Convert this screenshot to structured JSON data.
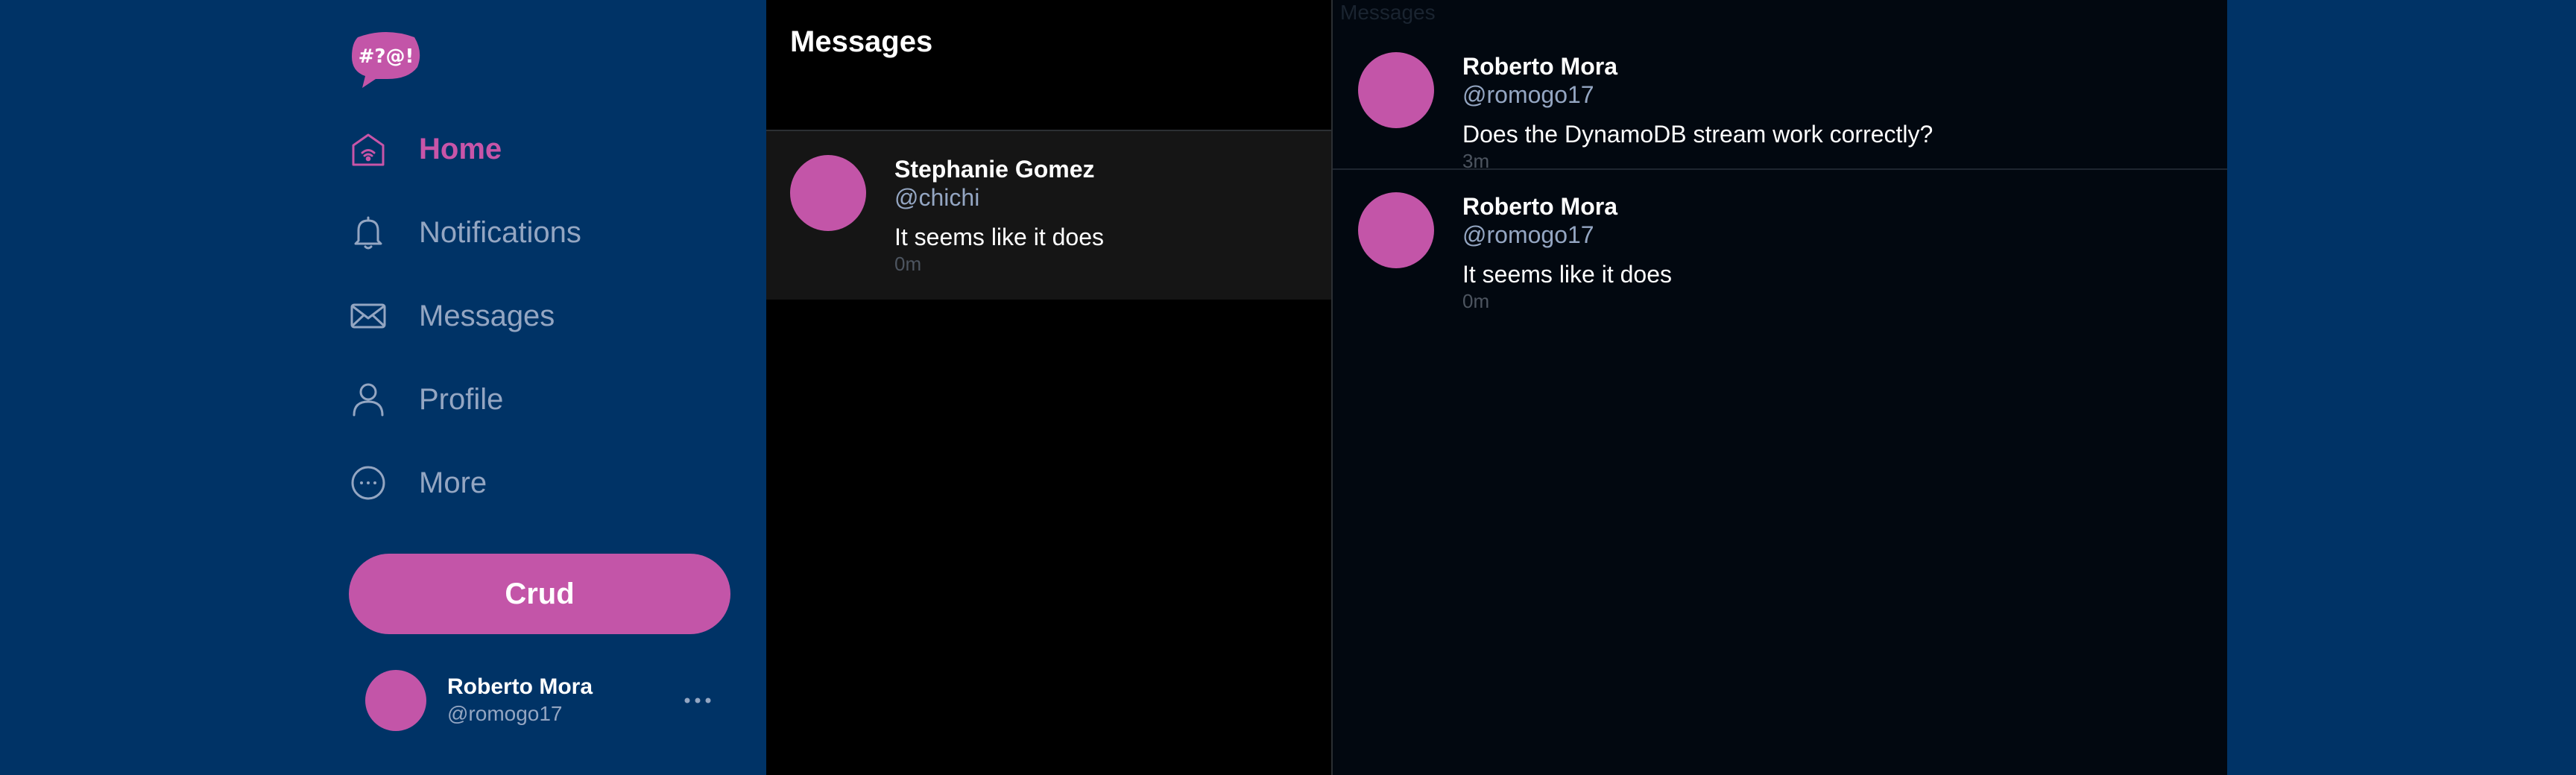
{
  "app": {
    "logo_text": "#?@!"
  },
  "sidebar": {
    "items": [
      {
        "label": "Home",
        "icon": "home-icon",
        "active": true
      },
      {
        "label": "Notifications",
        "icon": "bell-icon",
        "active": false
      },
      {
        "label": "Messages",
        "icon": "envelope-icon",
        "active": false
      },
      {
        "label": "Profile",
        "icon": "user-icon",
        "active": false
      },
      {
        "label": "More",
        "icon": "more-circle-icon",
        "active": false
      }
    ],
    "crud_label": "Crud"
  },
  "account": {
    "name": "Roberto Mora",
    "handle": "@romogo17"
  },
  "messages": {
    "title": "Messages",
    "conversations": [
      {
        "name": "Stephanie Gomez",
        "handle": "@chichi",
        "last_message": "It seems like it does",
        "time": "0m"
      }
    ]
  },
  "thread": {
    "column_label": "Messages",
    "messages": [
      {
        "name": "Roberto Mora",
        "handle": "@romogo17",
        "body": "Does the DynamoDB stream work correctly?",
        "time": "3m"
      },
      {
        "name": "Roberto Mora",
        "handle": "@romogo17",
        "body": "It seems like it does",
        "time": "0m"
      }
    ]
  },
  "colors": {
    "background": "#003366",
    "accent": "#c355a8",
    "muted_text": "#94a6c2",
    "panel": "#000000"
  }
}
